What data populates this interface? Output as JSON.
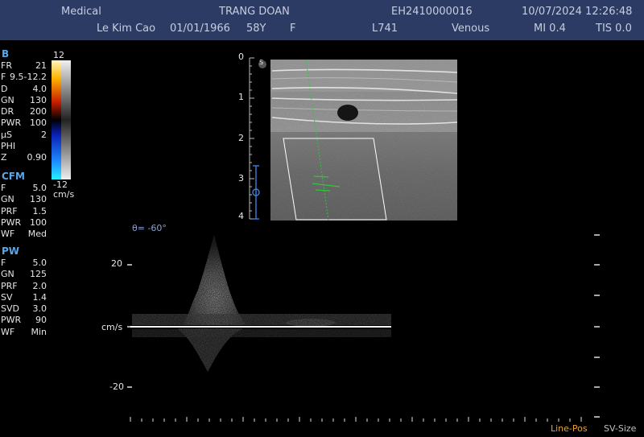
{
  "header": {
    "institution": "Medical",
    "patient_name": "TRANG DOAN",
    "exam_id": "EH2410000016",
    "datetime": "10/07/2024 12:26:48",
    "operator": "Le Kim Cao",
    "dob": "01/01/1966",
    "age": "58Y",
    "sex": "F",
    "probe": "L741",
    "preset": "Venous",
    "mi": "MI 0.4",
    "tis": "TIS 0.0"
  },
  "b_mode": {
    "title": "B",
    "params": [
      {
        "k": "FR",
        "v": "21"
      },
      {
        "k": "F",
        "v": "9.5-12.2"
      },
      {
        "k": "D",
        "v": "4.0"
      },
      {
        "k": "GN",
        "v": "130"
      },
      {
        "k": "DR",
        "v": "200"
      },
      {
        "k": "PWR",
        "v": "100"
      },
      {
        "k": "µS",
        "v": "2"
      },
      {
        "k": "PHI",
        "v": ""
      },
      {
        "k": "Z",
        "v": "0.90"
      }
    ]
  },
  "color_bar": {
    "top": "12",
    "bottom": "-12",
    "unit": "cm/s"
  },
  "cfm": {
    "title": "CFM",
    "params": [
      {
        "k": "F",
        "v": "5.0"
      },
      {
        "k": "GN",
        "v": "130"
      },
      {
        "k": "PRF",
        "v": "1.5"
      },
      {
        "k": "PWR",
        "v": "100"
      },
      {
        "k": "WF",
        "v": "Med"
      }
    ]
  },
  "pw": {
    "title": "PW",
    "params": [
      {
        "k": "F",
        "v": "5.0"
      },
      {
        "k": "GN",
        "v": "125"
      },
      {
        "k": "PRF",
        "v": "2.0"
      },
      {
        "k": "SV",
        "v": "1.4"
      },
      {
        "k": "SVD",
        "v": "3.0"
      },
      {
        "k": "PWR",
        "v": "90"
      },
      {
        "k": "WF",
        "v": "Min"
      }
    ]
  },
  "depth_scale": [
    "0",
    "1",
    "2",
    "3",
    "4"
  ],
  "angle_label": "θ= -60°",
  "spectrum_scale": {
    "upper": "20",
    "baseline": "cm/s",
    "lower": "-20"
  },
  "orientation_marker": "S",
  "footer": {
    "line_pos": "Line-Pos",
    "sv_size": "SV-Size"
  },
  "colors": {
    "header_bg": "#2c3b63",
    "section_title": "#5aa7e8",
    "footer_line_pos": "#e8a23a",
    "footer_sv_size": "#bfbfbf"
  }
}
